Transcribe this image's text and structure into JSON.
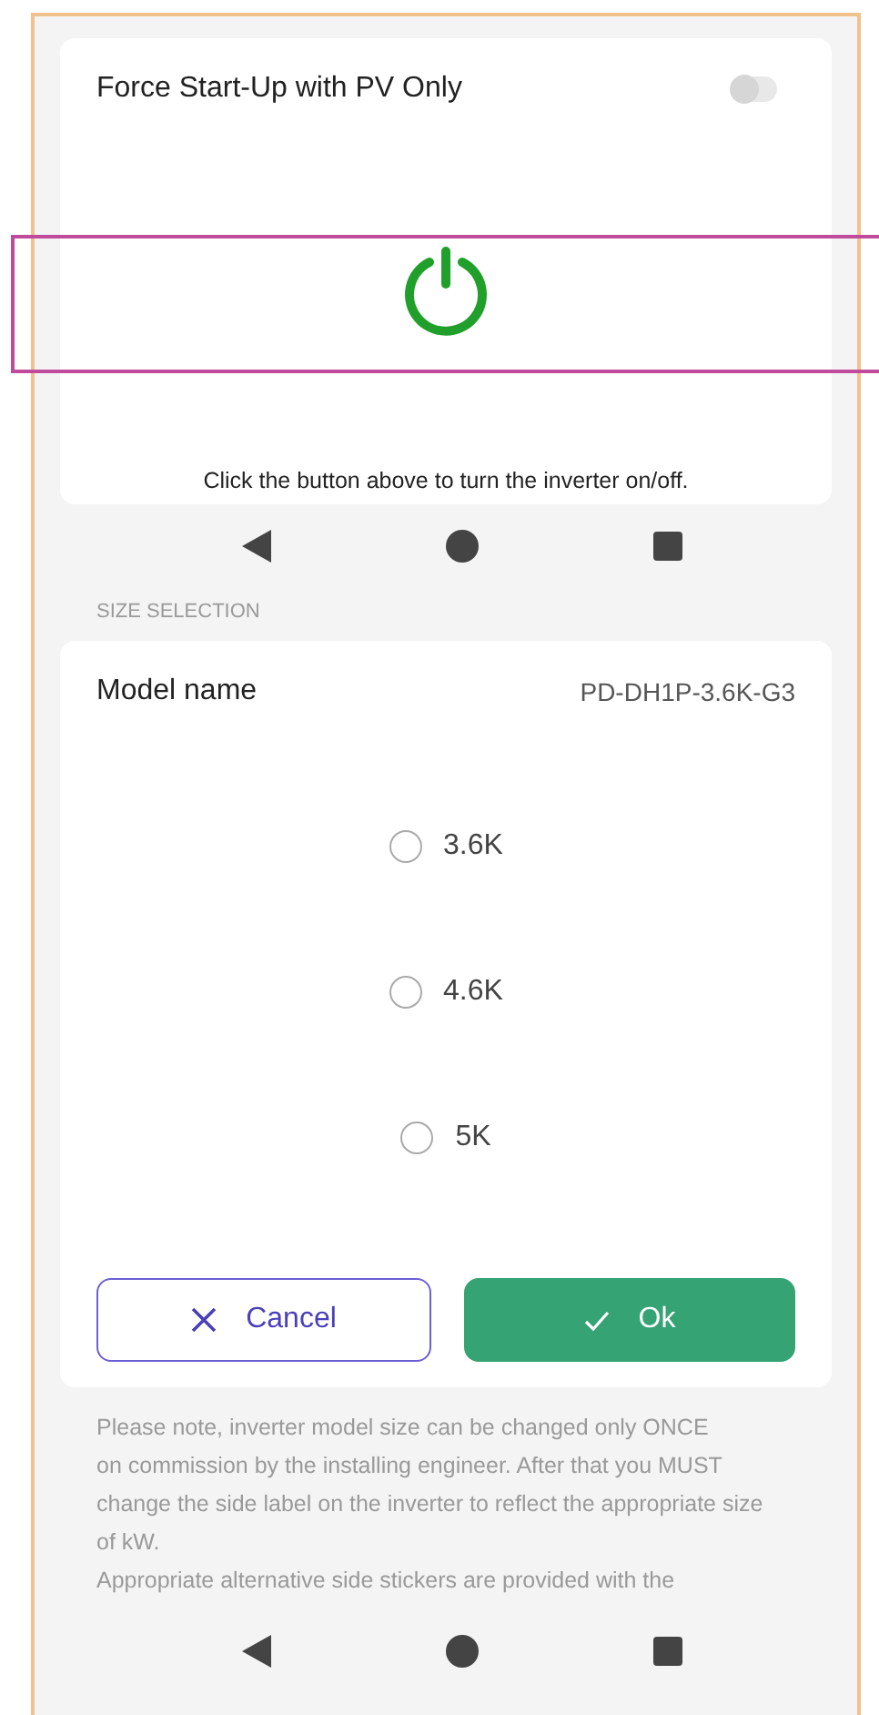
{
  "power_section": {
    "force_startup": {
      "label": "Force Start-Up with PV Only",
      "on": false
    },
    "caption": "Click the button above to turn the inverter on/off."
  },
  "size_section": {
    "heading": "SIZE SELECTION",
    "model_label": "Model name",
    "model_value": "PD-DH1P-3.6K-G3",
    "options": [
      {
        "label": "3.6K",
        "selected": false
      },
      {
        "label": "4.6K",
        "selected": false
      },
      {
        "label": "5K",
        "selected": false
      }
    ],
    "buttons": [
      {
        "kind": "cancel",
        "label": "Cancel"
      },
      {
        "kind": "ok",
        "label": "Ok"
      }
    ],
    "note": [
      "Please note, inverter model size can be changed only ONCE",
      "on commission by the installing engineer. After that you MUST",
      "change the side label on the inverter to reflect the appropriate size",
      "of kW.",
      "Appropriate alternative side stickers are provided with the"
    ]
  }
}
